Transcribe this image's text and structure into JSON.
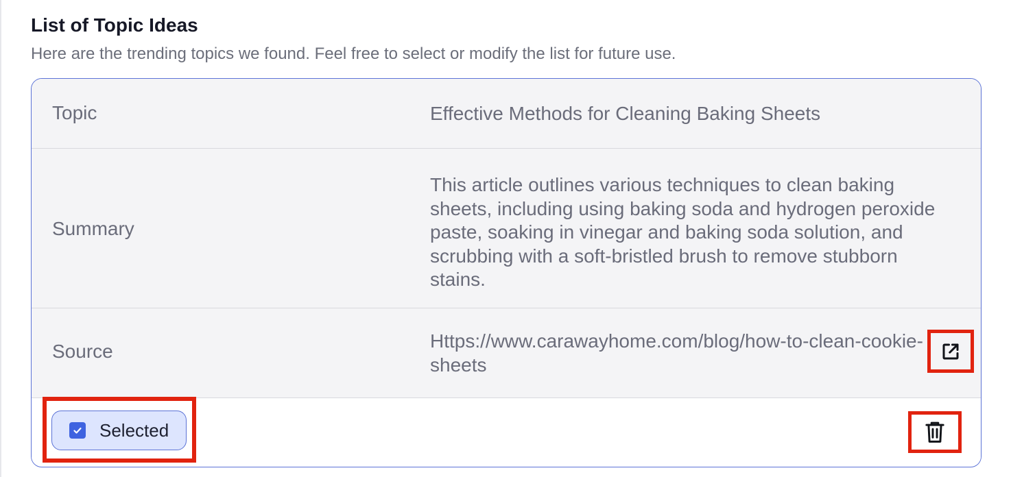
{
  "section": {
    "title": "List of Topic Ideas",
    "subtitle": "Here are the trending topics we found. Feel free to select or modify the list for future use."
  },
  "topic_card": {
    "rows": [
      {
        "label": "Topic",
        "value": "Effective Methods for Cleaning Baking Sheets"
      },
      {
        "label": "Summary",
        "value": "This article outlines various techniques to clean baking sheets, including using baking soda and hydrogen peroxide paste, soaking in vinegar and baking soda solution, and scrubbing with a soft-bristled brush to remove stubborn stains."
      },
      {
        "label": "Source",
        "value": "Https://www.carawayhome.com/blog/how-to-clean-cookie-sheets"
      }
    ],
    "selected_label": "Selected",
    "selected_checked": true,
    "icons": {
      "open_link": "external-link-icon",
      "delete": "trash-icon",
      "check": "check-icon"
    }
  },
  "colors": {
    "accent": "#3e63e0",
    "chip_bg": "#dde5fe",
    "highlight_border": "#e1230f",
    "card_border": "#5b72d6",
    "row_bg": "#f4f4f6"
  }
}
